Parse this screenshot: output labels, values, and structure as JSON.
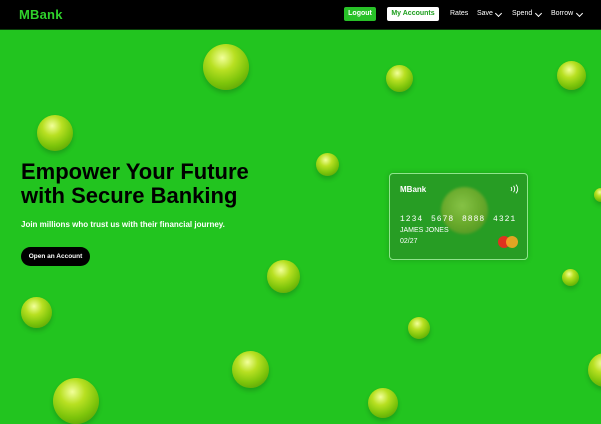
{
  "nav": {
    "logo": "MBank",
    "logout": "Logout",
    "my_accounts": "My Accounts",
    "links": [
      "Rates",
      "Save",
      "Spend",
      "Borrow"
    ]
  },
  "hero": {
    "headline_line1": "Empower Your Future",
    "headline_line2": "with Secure Banking",
    "subtitle": "Join millions who trust us with their financial journey.",
    "cta": "Open an Account"
  },
  "card": {
    "bank": "MBank",
    "number": "1234 5678 8888 4321",
    "holder": "JAMES JONES",
    "expiry": "02/27",
    "network_icon": "mastercard-logo",
    "contactless_icon": "contactless-icon"
  },
  "colors": {
    "background": "#22c41f",
    "nav_bg": "#000000",
    "accent": "#2fd12b"
  }
}
